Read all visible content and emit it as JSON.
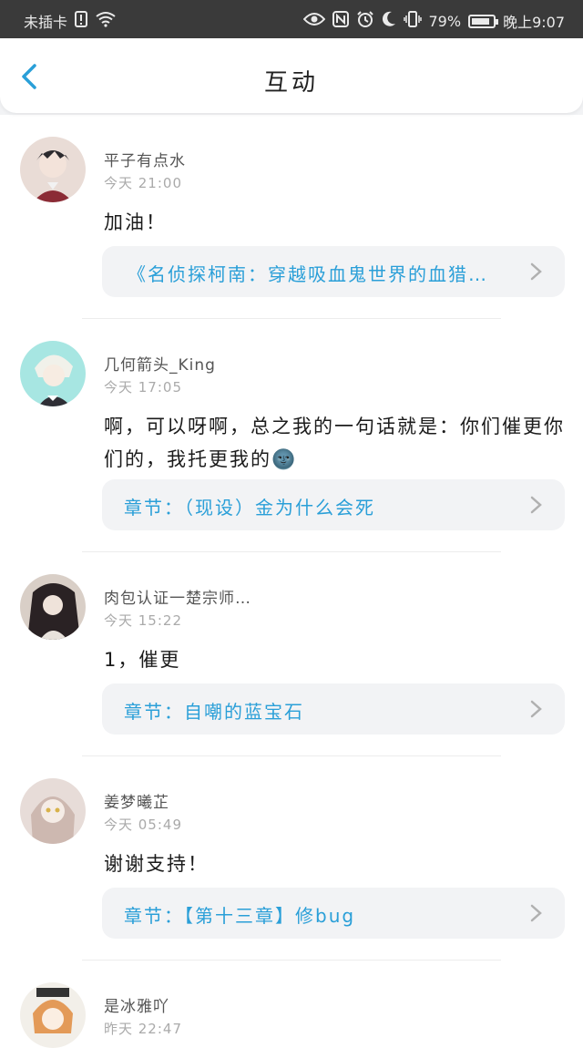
{
  "statusbar": {
    "carrier": "未插卡",
    "battery": "79%",
    "battery_level": 0.79,
    "time": "晚上9:07",
    "icons": [
      "sim-alert-icon",
      "wifi-icon",
      "eye-icon",
      "nfc-icon",
      "alarm-icon",
      "moon-icon",
      "vibrate-icon",
      "battery-icon"
    ]
  },
  "header": {
    "title": "互动",
    "back_icon": "chevron-left-icon",
    "accent": "#2a9fd8"
  },
  "items": [
    {
      "name": "平子有点水",
      "time": "今天 21:00",
      "text": "加油！",
      "link": "《名侦探柯南：穿越吸血鬼世界的血猎…",
      "avatar_color": "#c48a7a"
    },
    {
      "name": "几何箭头_King",
      "time": "今天 17:05",
      "text": "啊，可以呀啊，总之我的一句话就是：你们催更你们的，我托更我的🌚",
      "link": "章节：（现设）金为什么会死",
      "avatar_color": "#9fe0e0"
    },
    {
      "name": "肉包认证一楚宗师…",
      "time": "今天 15:22",
      "text": "1，催更",
      "link": "章节：自嘲的蓝宝石",
      "avatar_color": "#6b5a52"
    },
    {
      "name": "姜梦曦芷",
      "time": "今天 05:49",
      "text": "谢谢支持！",
      "link": "章节：【第十三章】修bug",
      "avatar_color": "#d8c8c4"
    },
    {
      "name": "是冰雅吖",
      "time": "昨天 22:47",
      "text": "",
      "link": "",
      "avatar_color": "#e8a060"
    }
  ]
}
